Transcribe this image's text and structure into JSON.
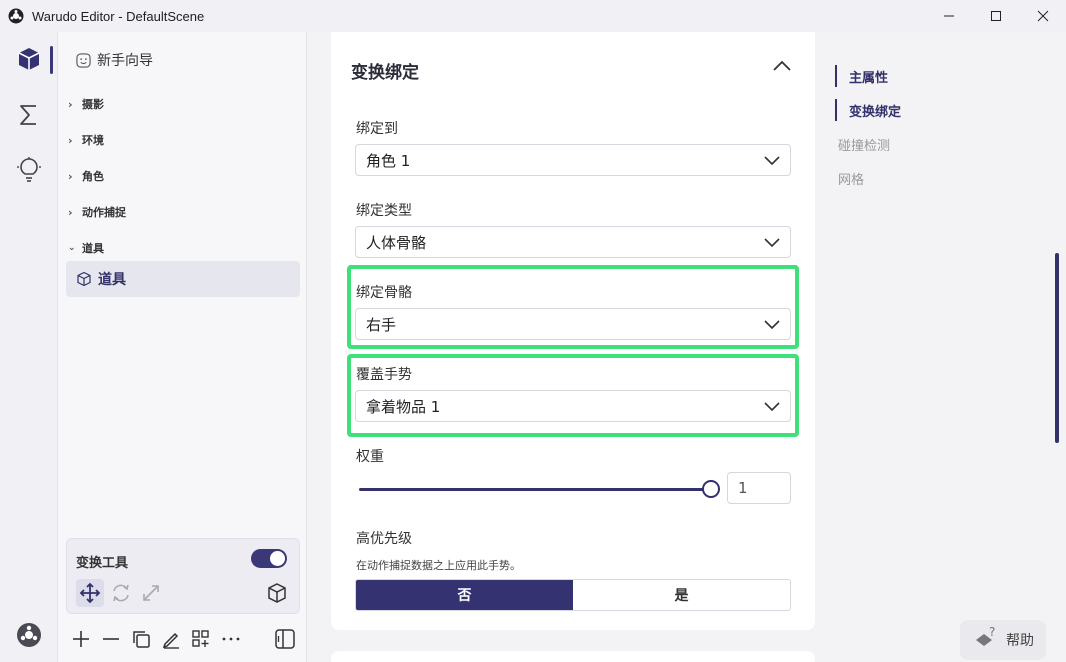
{
  "window": {
    "title": "Warudo Editor - DefaultScene"
  },
  "tree": {
    "wizard_label": "新手向导",
    "categories": [
      "摄影",
      "环境",
      "角色",
      "动作捕捉",
      "道具"
    ],
    "selected_item": "道具"
  },
  "tool_panel": {
    "title": "变换工具",
    "toggle_on": true
  },
  "section": {
    "title": "变换绑定",
    "fields": {
      "bind_to": {
        "label": "绑定到",
        "value": "角色 1"
      },
      "bind_type": {
        "label": "绑定类型",
        "value": "人体骨骼"
      },
      "bind_bone": {
        "label": "绑定骨骼",
        "value": "右手"
      },
      "override_gesture": {
        "label": "覆盖手势",
        "value": "拿着物品 1"
      },
      "weight": {
        "label": "权重",
        "value": "1",
        "slider_fraction": 1.0
      },
      "high_priority": {
        "label": "高优先级",
        "hint": "在动作捕捉数据之上应用此手势。",
        "options": [
          "否",
          "是"
        ],
        "selected": "否"
      }
    }
  },
  "toc": {
    "items": [
      "主属性",
      "变换绑定",
      "碰撞检测",
      "网格"
    ],
    "active": [
      "主属性",
      "变换绑定"
    ]
  },
  "help": {
    "label": "帮助"
  },
  "colors": {
    "accent": "#353272",
    "highlight": "#3ee07a"
  }
}
